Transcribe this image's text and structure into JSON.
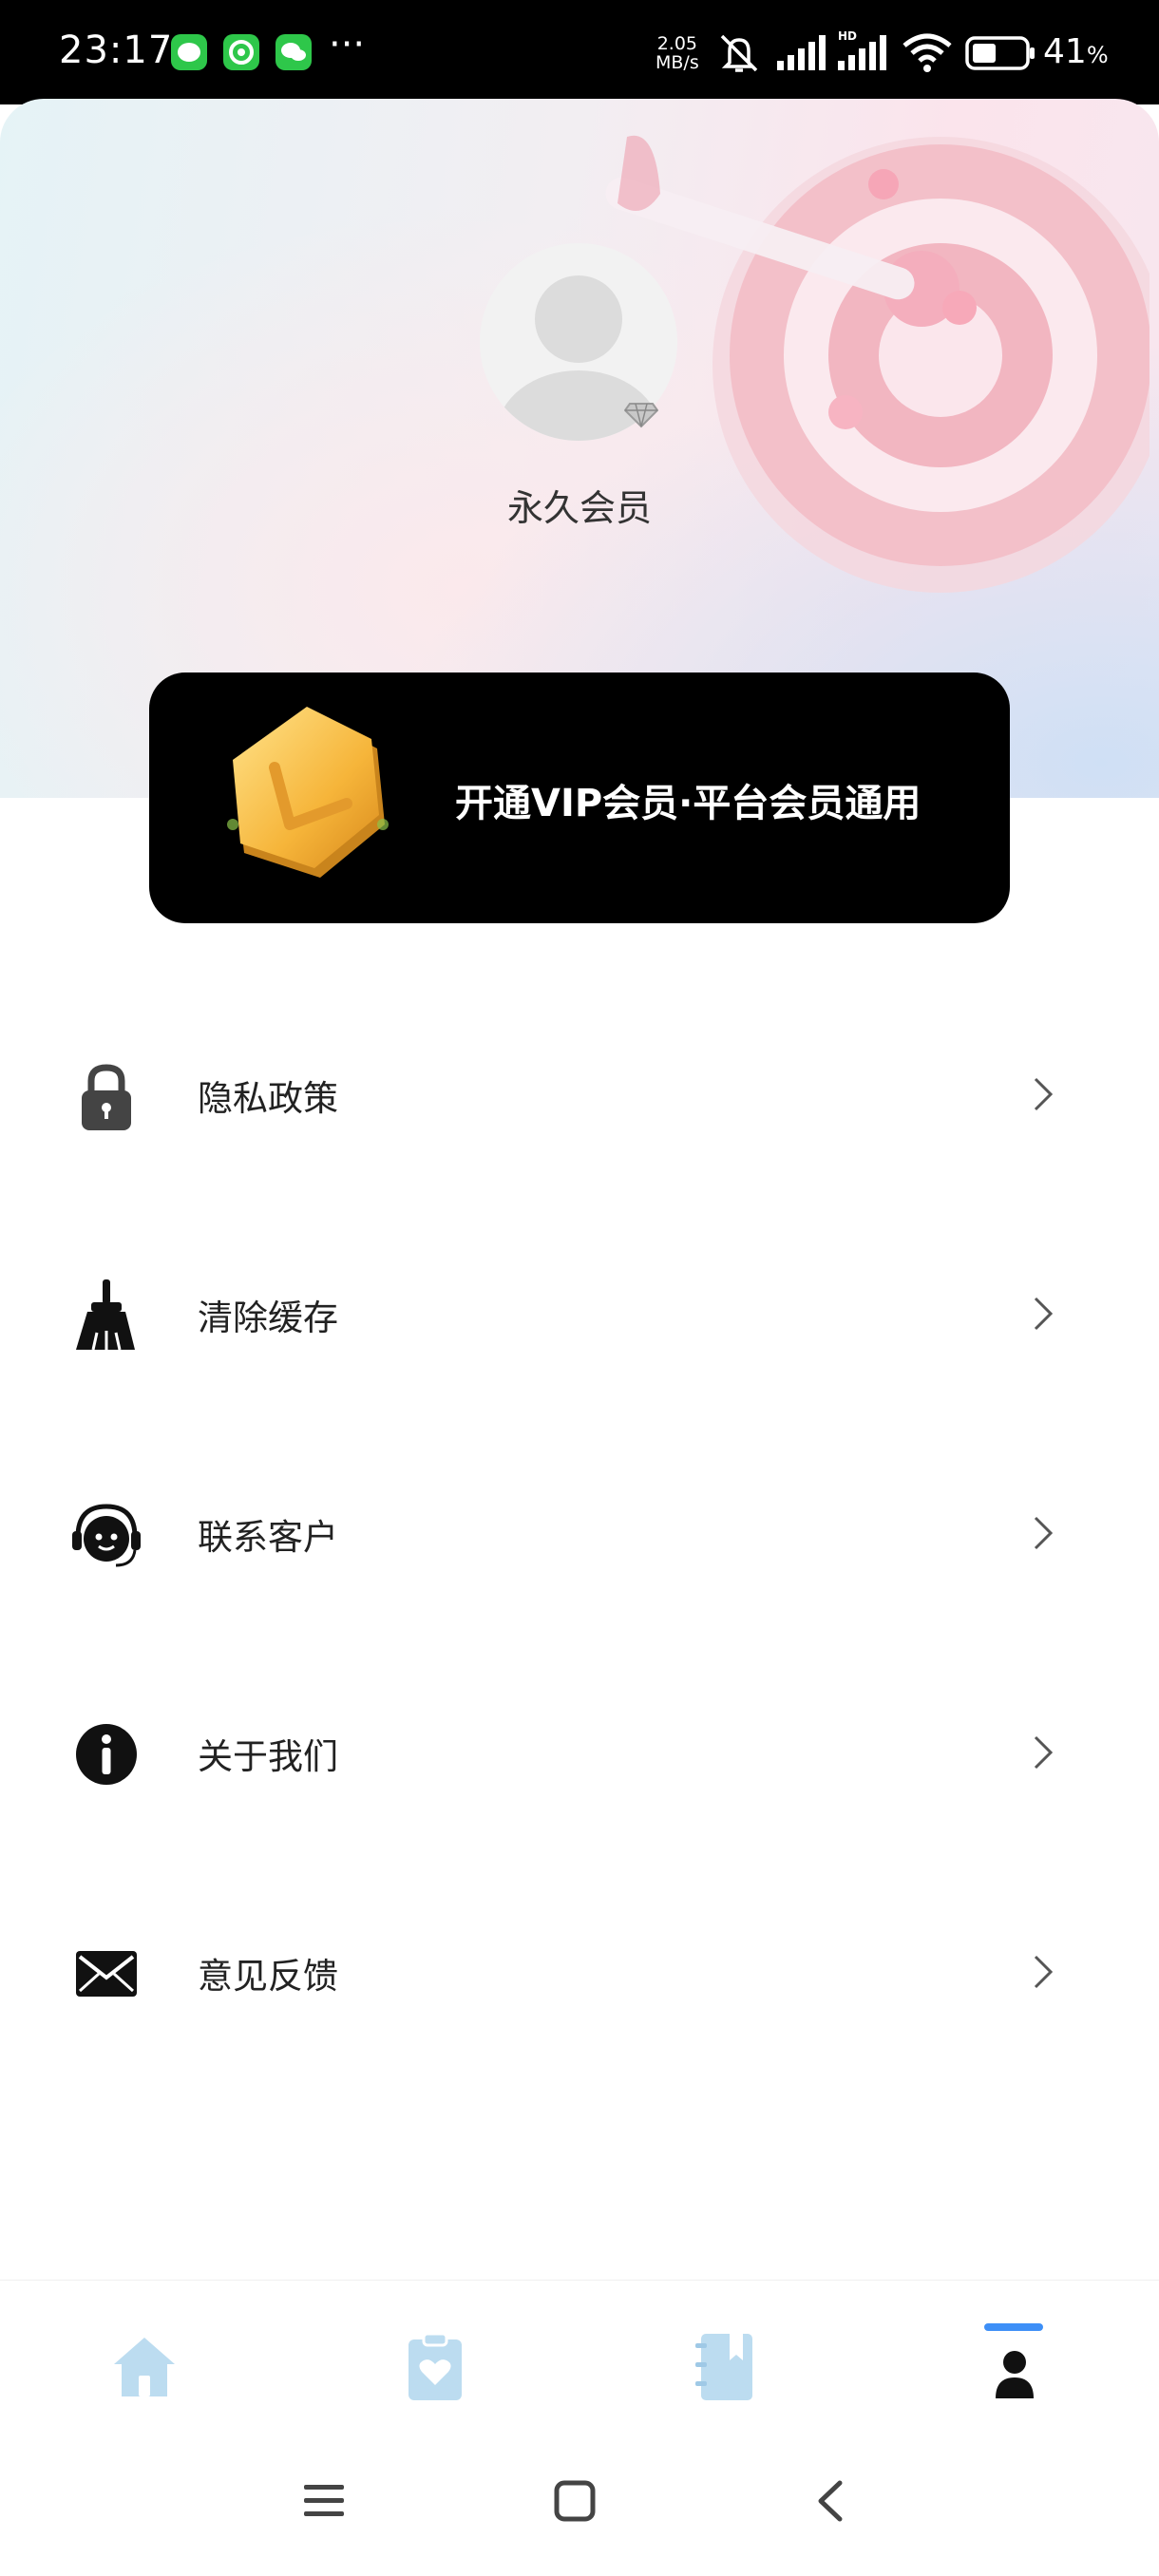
{
  "status_bar": {
    "time": "23:17",
    "net_speed_value": "2.05",
    "net_speed_unit": "MB/s",
    "hd_label": "HD",
    "battery_percent": "41",
    "battery_percent_sign": "%",
    "notification_apps": [
      "message-app-icon",
      "browser-app-icon",
      "wechat-icon"
    ],
    "more_indicator": "···"
  },
  "profile": {
    "username": "永久会员",
    "avatar_icon": "default-avatar-icon",
    "badge_icon": "diamond-icon"
  },
  "vip_banner": {
    "text": "开通VIP会员·平台会员通用",
    "icon": "gold-coin-icon"
  },
  "menu": {
    "items": [
      {
        "label": "隐私政策",
        "icon": "lock-icon"
      },
      {
        "label": "清除缓存",
        "icon": "broom-icon"
      },
      {
        "label": "联系客户",
        "icon": "headset-icon"
      },
      {
        "label": "关于我们",
        "icon": "info-icon"
      },
      {
        "label": "意见反馈",
        "icon": "mail-icon"
      }
    ]
  },
  "bottom_nav": {
    "tabs": [
      {
        "icon": "home-icon",
        "active": false
      },
      {
        "icon": "clipboard-heart-icon",
        "active": false
      },
      {
        "icon": "notebook-icon",
        "active": false
      },
      {
        "icon": "profile-icon",
        "active": true
      }
    ]
  },
  "colors": {
    "status_bar": "#000000",
    "vip_banner_bg": "#000000",
    "active_indicator": "#3d8ff7",
    "inactive_tab_icon": "#bcdcf0",
    "chevron": "#555555"
  }
}
